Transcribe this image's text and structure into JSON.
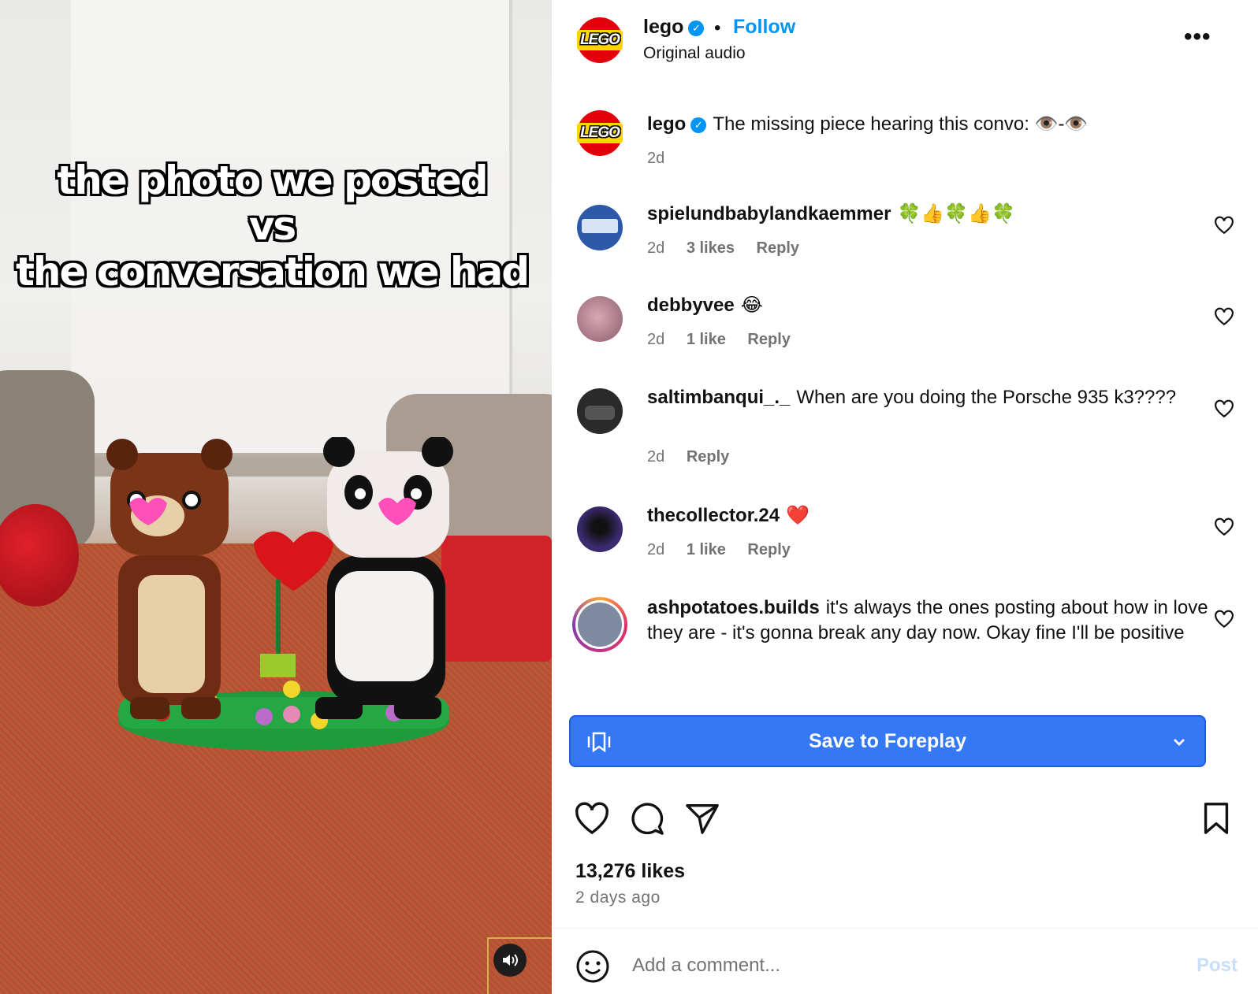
{
  "media": {
    "caption_lines": [
      "the photo we posted",
      "vs",
      "the conversation we had"
    ],
    "audio_icon": "speaker-icon"
  },
  "header": {
    "username": "lego",
    "follow_label": "Follow",
    "audio_label": "Original audio",
    "avatar_text": "LEGO"
  },
  "caption": {
    "username": "lego",
    "text": "The missing piece hearing this convo: 👁️-👁️",
    "time": "2d"
  },
  "comments": [
    {
      "username": "spielundbabylandkaemmer",
      "text": "🍀👍🍀👍🍀",
      "time": "2d",
      "likes": "3 likes",
      "reply": "Reply",
      "avatar_color": "#2d5aa8"
    },
    {
      "username": "debbyvee",
      "text": "😂",
      "time": "2d",
      "likes": "1 like",
      "reply": "Reply",
      "avatar_color": "#b07f8e"
    },
    {
      "username": "saltimbanqui_._",
      "text": "When are you doing the Porsche 935 k3????",
      "time": "2d",
      "likes": "",
      "reply": "Reply",
      "avatar_color": "#2a2a2a"
    },
    {
      "username": "thecollector.24",
      "text": "❤️",
      "time": "2d",
      "likes": "1 like",
      "reply": "Reply",
      "avatar_color": "#3b2a6e"
    },
    {
      "username": "ashpotatoes.builds",
      "text": "it's always the ones posting about how in love they are - it's gonna break any day now. Okay fine I'll be positive",
      "time": "",
      "likes": "",
      "reply": "",
      "avatar_color": "#7d8aa0"
    }
  ],
  "save_button": {
    "label": "Save to Foreplay"
  },
  "stats": {
    "likes": "13,276 likes",
    "posted": "2 days ago"
  },
  "comment_box": {
    "placeholder": "Add a comment...",
    "post_label": "Post"
  },
  "colors": {
    "accent": "#0095f6",
    "lego_red": "#e3000b",
    "save_blue": "#3478f6"
  }
}
